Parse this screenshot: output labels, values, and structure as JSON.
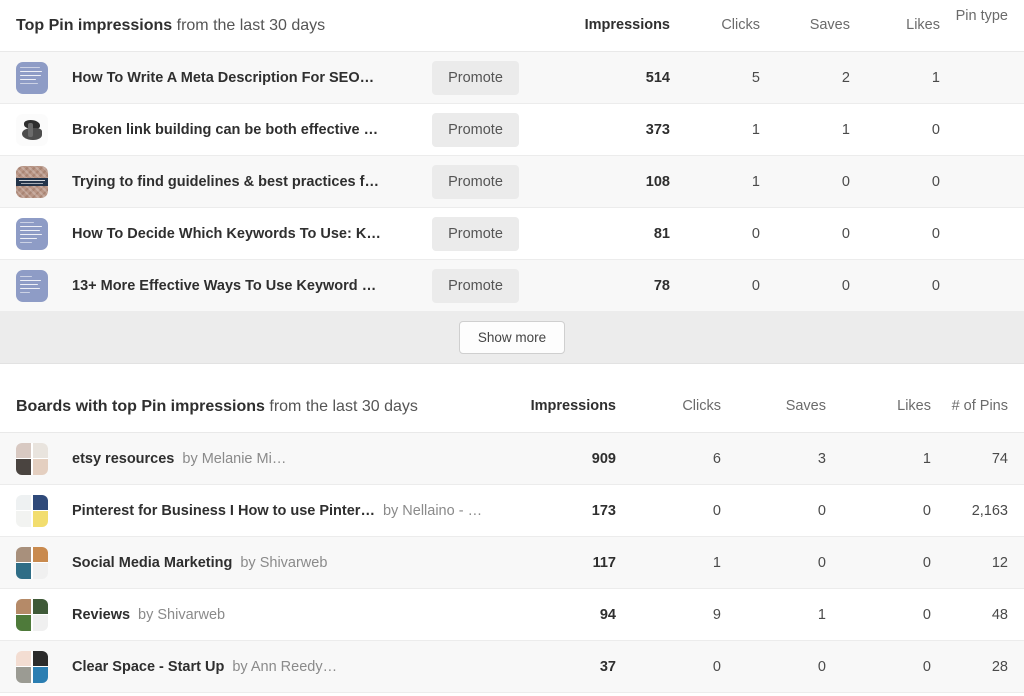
{
  "pin_section": {
    "title_bold": "Top Pin impressions",
    "title_rest": " from the last 30 days",
    "columns": [
      "Impressions",
      "Clicks",
      "Saves",
      "Likes",
      "Pin type"
    ],
    "action_label": "Promote",
    "show_more_label": "Show more",
    "rows": [
      {
        "title": "How To Write A Meta Description For SEO…",
        "impressions": "514",
        "clicks": "5",
        "saves": "2",
        "likes": "1",
        "pin_type": "",
        "thumb": "text-card-periwinkle"
      },
      {
        "title": "Broken link building can be both effective …",
        "impressions": "373",
        "clicks": "1",
        "saves": "1",
        "likes": "0",
        "pin_type": "",
        "thumb": "photo-white"
      },
      {
        "title": "Trying to find guidelines & best practices f…",
        "impressions": "108",
        "clicks": "1",
        "saves": "0",
        "likes": "0",
        "pin_type": "",
        "thumb": "photo-brown-quilt"
      },
      {
        "title": "How To Decide Which Keywords To Use: K…",
        "impressions": "81",
        "clicks": "0",
        "saves": "0",
        "likes": "0",
        "pin_type": "",
        "thumb": "text-card-periwinkle"
      },
      {
        "title": "13+ More Effective Ways To Use Keyword …",
        "impressions": "78",
        "clicks": "0",
        "saves": "0",
        "likes": "0",
        "pin_type": "",
        "thumb": "text-card-periwinkle"
      }
    ]
  },
  "board_section": {
    "title_bold": "Boards with top Pin impressions",
    "title_rest": " from the last 30 days",
    "columns": [
      "Impressions",
      "Clicks",
      "Saves",
      "Likes",
      "# of Pins"
    ],
    "rows": [
      {
        "name": "etsy resources",
        "by": "by Melanie Mi…",
        "impressions": "909",
        "clicks": "6",
        "saves": "3",
        "likes": "1",
        "pins": "74",
        "tiles": [
          "#d8c9c2",
          "#e9e4de",
          "#4a4440",
          "#e4cfc0"
        ]
      },
      {
        "name": "Pinterest for Business I How to use Pinter…",
        "by": "by Nellaino - …",
        "impressions": "173",
        "clicks": "0",
        "saves": "0",
        "likes": "0",
        "pins": "2,163",
        "tiles": [
          "#eef1f2",
          "#2f4a7a",
          "#f2f3f1",
          "#f2dd6e"
        ]
      },
      {
        "name": "Social Media Marketing",
        "by": "by Shivarweb",
        "impressions": "117",
        "clicks": "1",
        "saves": "0",
        "likes": "0",
        "pins": "12",
        "tiles": [
          "#a8907c",
          "#c98a4e",
          "#2f6d86",
          "#f0f0f0"
        ]
      },
      {
        "name": "Reviews",
        "by": "by Shivarweb",
        "impressions": "94",
        "clicks": "9",
        "saves": "1",
        "likes": "0",
        "pins": "48",
        "tiles": [
          "#b58a68",
          "#3f5a38",
          "#4e7a3a",
          "#f0f0f0"
        ]
      },
      {
        "name": "Clear Space - Start Up",
        "by": "by Ann Reedy…",
        "impressions": "37",
        "clicks": "0",
        "saves": "0",
        "likes": "0",
        "pins": "28",
        "tiles": [
          "#f3ddd2",
          "#2b2b2b",
          "#9b9b93",
          "#2b7eb2"
        ]
      }
    ]
  },
  "colors": {
    "row_alt": "#f8f8f8",
    "footer_band": "#ececec",
    "promote_bg": "#ebebeb",
    "thumb_periwinkle": "#8e9cc6"
  }
}
